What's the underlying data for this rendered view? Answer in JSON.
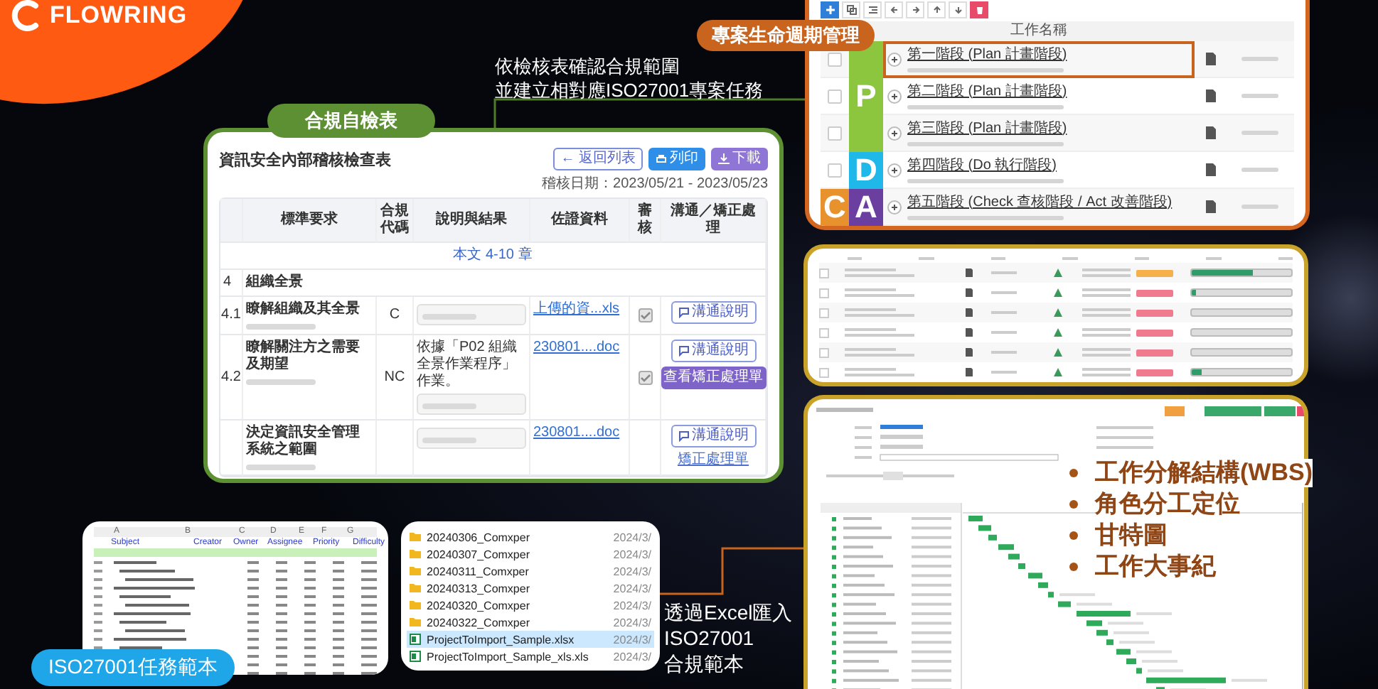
{
  "logo": {
    "text": "FLOWRING"
  },
  "lifecycle": {
    "badge": "專案生命週期管理",
    "column": "工作名稱",
    "pdca": [
      {
        "letter": "P",
        "color": "#8cc63f"
      },
      {
        "letter": "D",
        "color": "#1fb8e8"
      },
      {
        "letter": "C",
        "color": "#e8922e"
      },
      {
        "letter": "A",
        "color": "#6b3fa0"
      }
    ],
    "rows": [
      {
        "title": "第一階段 (Plan 計畫階段)",
        "highlighted": true,
        "checked": false
      },
      {
        "title": "第二階段 (Plan 計畫階段)",
        "highlighted": false,
        "checked": false
      },
      {
        "title": "第三階段 (Plan 計畫階段)",
        "highlighted": false,
        "checked": false
      },
      {
        "title": "第四階段 (Do 執行階段)",
        "highlighted": false,
        "checked": false
      },
      {
        "title": "第五階段 (Check 查核階段 / Act 改善階段)",
        "highlighted": false
      }
    ]
  },
  "caption": [
    "依檢核表確認合規範圍",
    "並建立相對應ISO27001專案任務"
  ],
  "checklist": {
    "badge": "合規自檢表",
    "title": "資訊安全內部稽核檢查表",
    "buttons": [
      {
        "label": "← 返回列表",
        "kind": "back"
      },
      {
        "label": "列印",
        "kind": "print"
      },
      {
        "label": "下載",
        "kind": "download"
      }
    ],
    "audit_date": "稽核日期：2023/05/21 - 2023/05/23",
    "columns": [
      "標準要求",
      "合規代碼",
      "說明與結果",
      "佐證資料",
      "審核",
      "溝通／矯正處理"
    ],
    "chapter": "本文 4-10 章",
    "section": {
      "number": "4",
      "title": "組織全景"
    },
    "rows": [
      {
        "number": "4.1",
        "title": "瞭解組織及其全景",
        "code": "C",
        "evidence": "上傳的資...xls",
        "reviewed": true,
        "actions": [
          {
            "label": "溝通說明",
            "kind": "outline"
          }
        ]
      },
      {
        "number": "4.2",
        "title": "瞭解關注方之需要及期望",
        "code": "NC",
        "result": "依據「P02 組織全景作業程序」作業。",
        "evidence": "230801....doc",
        "reviewed": true,
        "actions": [
          {
            "label": "溝通說明",
            "kind": "outline"
          },
          {
            "label": "查看矯正處理單",
            "kind": "filled"
          }
        ]
      },
      {
        "title": "決定資訊安全管理系統之範圍",
        "evidence": "230801....doc",
        "reviewed": false,
        "actions": [
          {
            "label": "溝通說明",
            "kind": "outline"
          },
          {
            "label": "矯正處理單",
            "kind": "link"
          }
        ]
      }
    ]
  },
  "task_list": {
    "rows": [
      {
        "level": 0.62,
        "color": "#f5b04a",
        "checked": false
      },
      {
        "level": 0.04,
        "color": "#f07a8e",
        "checked": false
      },
      {
        "level": 0,
        "color": "#f07a8e",
        "checked": false
      },
      {
        "level": 0,
        "color": "#f07a8e",
        "checked": false
      },
      {
        "level": 0,
        "color": "#f07a8e",
        "checked": false
      },
      {
        "level": 0.1,
        "color": "#f07a8e",
        "checked": false
      }
    ]
  },
  "gantt_bullets": [
    "工作分解結構(WBS)",
    "角色分工定位",
    "甘特圖",
    "工作大事紀"
  ],
  "spreadsheet": {
    "column_letters": [
      "A",
      "B",
      "C",
      "D",
      "E",
      "F",
      "G"
    ],
    "columns": [
      "Subject",
      "Creator",
      "Owner",
      "Assignee",
      "Priority",
      "Difficulty"
    ],
    "badge": "ISO27001任務範本"
  },
  "files": [
    {
      "name": "20240306_Comxper",
      "kind": "folder",
      "date": "2024/3/",
      "selected": false
    },
    {
      "name": "20240307_Comxper",
      "kind": "folder",
      "date": "2024/3/",
      "selected": false
    },
    {
      "name": "20240311_Comxper",
      "kind": "folder",
      "date": "2024/3/",
      "selected": false
    },
    {
      "name": "20240313_Comxper",
      "kind": "folder",
      "date": "2024/3/",
      "selected": false
    },
    {
      "name": "20240320_Comxper",
      "kind": "folder",
      "date": "2024/3/",
      "selected": false
    },
    {
      "name": "20240322_Comxper",
      "kind": "folder",
      "date": "2024/3/",
      "selected": false
    },
    {
      "name": "ProjectToImport_Sample.xlsx",
      "kind": "excel",
      "date": "2024/3/",
      "selected": true
    },
    {
      "name": "ProjectToImport_Sample_xls.xls",
      "kind": "excel",
      "date": "2024/3/",
      "selected": false
    }
  ],
  "import_caption": [
    "透過Excel匯入",
    "ISO27001",
    "合規範本"
  ]
}
